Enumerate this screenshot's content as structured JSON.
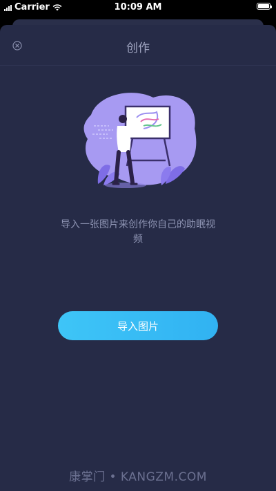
{
  "status_bar": {
    "carrier": "Carrier",
    "time": "10:09 AM"
  },
  "nav": {
    "title": "创作",
    "close_icon": "close-circle-icon"
  },
  "main": {
    "illustration": "painter-at-easel-illustration",
    "prompt_text": "导入一张图片来创作你自己的助眠视频",
    "import_button_label": "导入图片"
  },
  "watermark": {
    "text": "康掌门 • KANGZM.COM"
  },
  "colors": {
    "background": "#262b47",
    "accent": "#3ec5f7",
    "illustration_purple": "#9b8ef0"
  }
}
